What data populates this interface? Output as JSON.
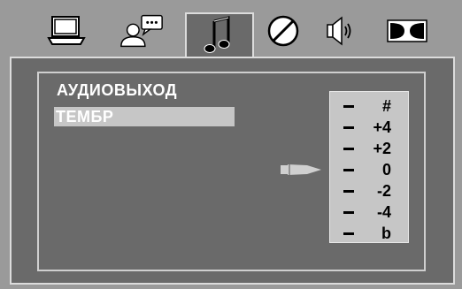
{
  "tabs": [
    {
      "name": "monitor",
      "icon": "monitor-icon",
      "active": false
    },
    {
      "name": "user-message",
      "icon": "user-message-icon",
      "active": false
    },
    {
      "name": "music",
      "icon": "music-note-icon",
      "active": true
    },
    {
      "name": "disc",
      "icon": "disc-icon",
      "active": false
    },
    {
      "name": "speaker",
      "icon": "speaker-icon",
      "active": false
    },
    {
      "name": "dolby",
      "icon": "dolby-icon",
      "active": false
    }
  ],
  "menu": {
    "items": [
      {
        "label": "АУДИОВЫХОД",
        "selected": false
      },
      {
        "label": "ТЕМБР",
        "selected": true
      }
    ]
  },
  "equalizer": {
    "levels": [
      "#",
      "+4",
      "+2",
      "0",
      "-2",
      "-4",
      "b"
    ],
    "current": "0"
  },
  "colors": {
    "background": "#9a9a9a",
    "panel": "#6a6a6a",
    "highlight": "#c6c6c6",
    "border": "#dcdcdc"
  }
}
